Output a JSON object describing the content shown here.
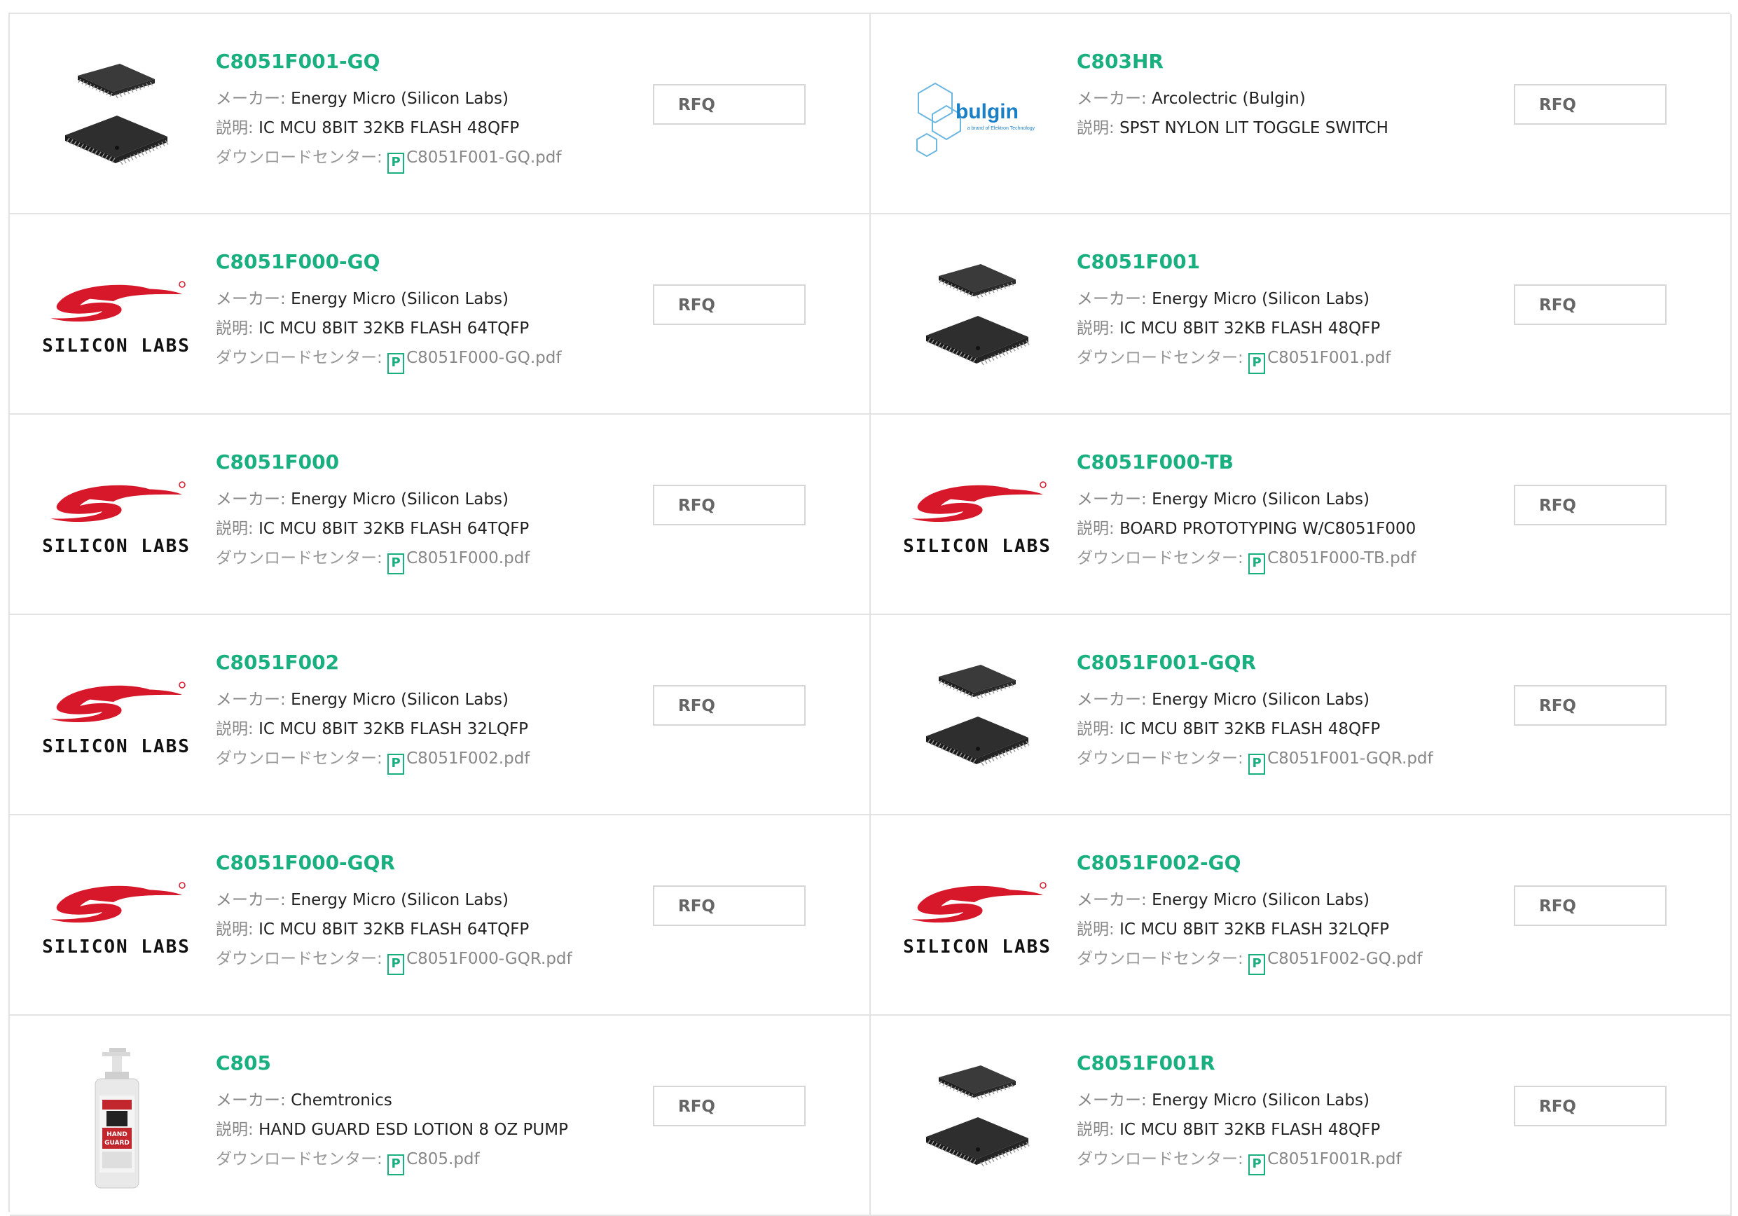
{
  "labels": {
    "maker": "メーカー: ",
    "desc": "説明: ",
    "download": "ダウンロードセンター: ",
    "pdf_glyph": "P",
    "rfq": "RFQ"
  },
  "brand": {
    "accent": "#1aaf7f",
    "silicon_labs_red": "#d7182a"
  },
  "products": [
    {
      "pn": "C8051F001-GQ",
      "maker": "Energy Micro (Silicon Labs)",
      "desc": "IC MCU 8BIT 32KB FLASH 48QFP",
      "pdf": "C8051F001-GQ.pdf",
      "image": "chip-image"
    },
    {
      "pn": "C803HR",
      "maker": "Arcolectric (Bulgin)",
      "desc": "SPST NYLON LIT TOGGLE SWITCH",
      "pdf": "",
      "image": "bulgin-logo",
      "logo_text": "bulgin",
      "logo_sub": "a brand of Elektron Technology"
    },
    {
      "pn": "C8051F000-GQ",
      "maker": "Energy Micro (Silicon Labs)",
      "desc": "IC MCU 8BIT 32KB FLASH 64TQFP",
      "pdf": "C8051F000-GQ.pdf",
      "image": "silicon-labs-logo",
      "logo_text": "SILICON LABS"
    },
    {
      "pn": "C8051F001",
      "maker": "Energy Micro (Silicon Labs)",
      "desc": "IC MCU 8BIT 32KB FLASH 48QFP",
      "pdf": "C8051F001.pdf",
      "image": "chip-image"
    },
    {
      "pn": "C8051F000",
      "maker": "Energy Micro (Silicon Labs)",
      "desc": "IC MCU 8BIT 32KB FLASH 64TQFP",
      "pdf": "C8051F000.pdf",
      "image": "silicon-labs-logo",
      "logo_text": "SILICON LABS"
    },
    {
      "pn": "C8051F000-TB",
      "maker": "Energy Micro (Silicon Labs)",
      "desc": "BOARD PROTOTYPING W/C8051F000",
      "pdf": "C8051F000-TB.pdf",
      "image": "silicon-labs-logo",
      "logo_text": "SILICON LABS"
    },
    {
      "pn": "C8051F002",
      "maker": "Energy Micro (Silicon Labs)",
      "desc": "IC MCU 8BIT 32KB FLASH 32LQFP",
      "pdf": "C8051F002.pdf",
      "image": "silicon-labs-logo",
      "logo_text": "SILICON LABS"
    },
    {
      "pn": "C8051F001-GQR",
      "maker": "Energy Micro (Silicon Labs)",
      "desc": "IC MCU 8BIT 32KB FLASH 48QFP",
      "pdf": "C8051F001-GQR.pdf",
      "image": "chip-image"
    },
    {
      "pn": "C8051F000-GQR",
      "maker": "Energy Micro (Silicon Labs)",
      "desc": "IC MCU 8BIT 32KB FLASH 64TQFP",
      "pdf": "C8051F000-GQR.pdf",
      "image": "silicon-labs-logo",
      "logo_text": "SILICON LABS"
    },
    {
      "pn": "C8051F002-GQ",
      "maker": "Energy Micro (Silicon Labs)",
      "desc": "IC MCU 8BIT 32KB FLASH 32LQFP",
      "pdf": "C8051F002-GQ.pdf",
      "image": "silicon-labs-logo",
      "logo_text": "SILICON LABS"
    },
    {
      "pn": "C805",
      "maker": "Chemtronics",
      "desc": "HAND GUARD ESD LOTION 8 OZ PUMP",
      "pdf": "C805.pdf",
      "image": "lotion-bottle-image"
    },
    {
      "pn": "C8051F001R",
      "maker": "Energy Micro (Silicon Labs)",
      "desc": "IC MCU 8BIT 32KB FLASH 48QFP",
      "pdf": "C8051F001R.pdf",
      "image": "chip-image"
    }
  ]
}
